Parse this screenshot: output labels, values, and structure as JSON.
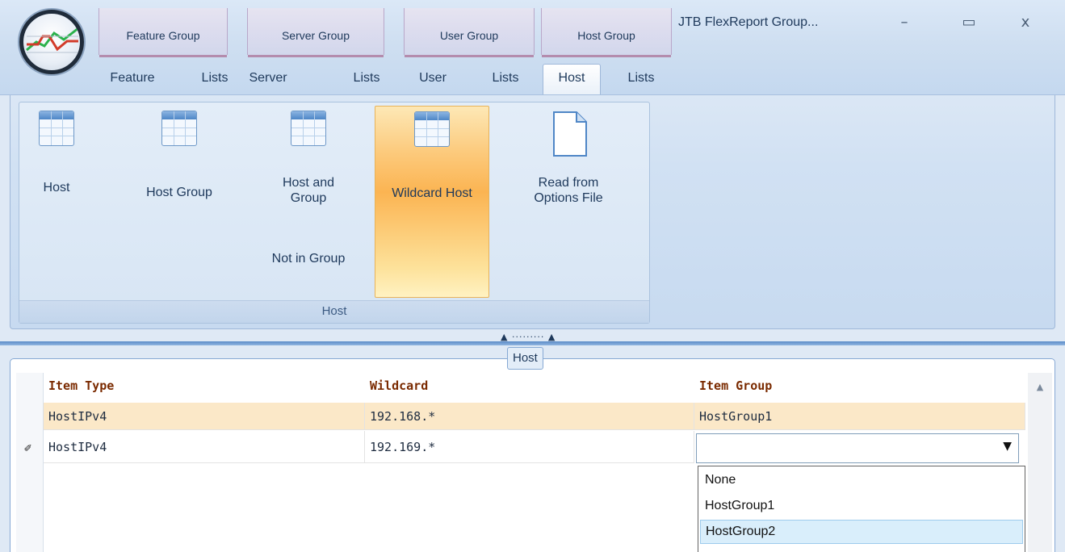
{
  "window": {
    "title": "JTB FlexReport Group...",
    "controls": {
      "minimize": "–",
      "maximize": "▭",
      "close": "x"
    }
  },
  "context_tabs": [
    {
      "label": "Feature Group"
    },
    {
      "label": "Server Group"
    },
    {
      "label": "User Group"
    },
    {
      "label": "Host Group"
    }
  ],
  "ribbon_tabs": [
    {
      "label": "Feature"
    },
    {
      "label": "Lists"
    },
    {
      "label": "Server"
    },
    {
      "label": "Lists"
    },
    {
      "label": "User"
    },
    {
      "label": "Lists"
    },
    {
      "label": "Host",
      "active": true
    },
    {
      "label": "Lists"
    }
  ],
  "ribbon_group": {
    "caption": "Host",
    "buttons": {
      "host": {
        "label": "Host",
        "icon": "grid-icon"
      },
      "host_group": {
        "label": "Host Group",
        "icon": "grid-icon"
      },
      "host_and_group": {
        "label_line1": "Host and",
        "label_line2": "Group",
        "sub_label": "Not in Group",
        "icon": "grid-icon"
      },
      "wildcard_host": {
        "label": "Wildcard Host",
        "icon": "grid-icon",
        "active": true
      },
      "read_options": {
        "label_line1": "Read from",
        "label_line2": "Options File",
        "icon": "document-icon"
      }
    }
  },
  "splitter": {
    "grip": "▲ ········· ▲"
  },
  "panel": {
    "caption": "Host"
  },
  "grid": {
    "columns": [
      "Item Type",
      "Wildcard",
      "Item Group"
    ],
    "rows": [
      {
        "item_type": "HostIPv4",
        "wildcard": "192.168.*",
        "item_group": "HostGroup1"
      },
      {
        "item_type": "HostIPv4",
        "wildcard": "192.169.*",
        "item_group": ""
      }
    ],
    "edit_indicator": "✐"
  },
  "dropdown": {
    "options": [
      "None",
      "HostGroup1",
      "HostGroup2"
    ],
    "hover_index": 2
  },
  "colors": {
    "accent": "#fbb452",
    "header_text": "#7a2a00",
    "selected_row": "#fbe8c8"
  }
}
